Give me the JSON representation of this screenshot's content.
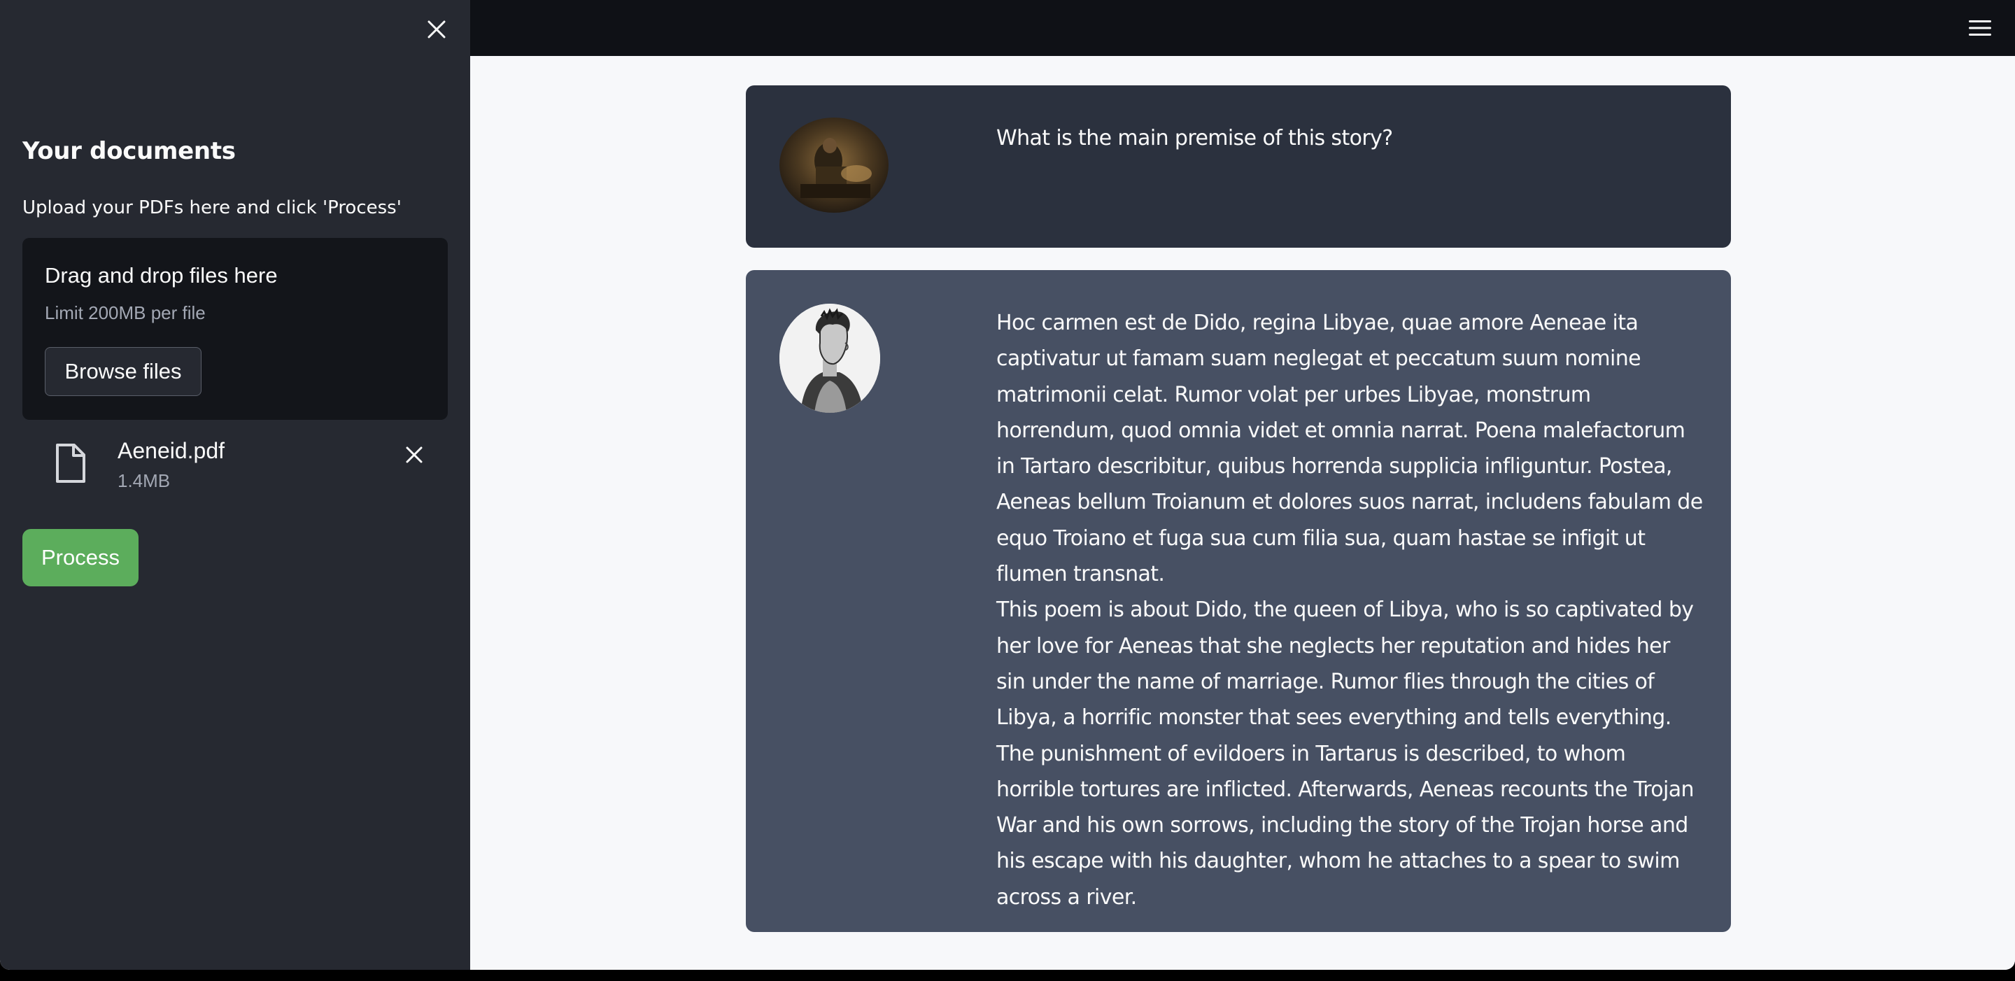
{
  "sidebar": {
    "title": "Your documents",
    "subtitle": "Upload your PDFs here and click 'Process'",
    "close_icon": "close-icon",
    "uploader": {
      "drag_text": "Drag and drop files here",
      "limit_text": "Limit 200MB per file",
      "browse_label": "Browse files"
    },
    "file": {
      "name": "Aeneid.pdf",
      "size": "1.4MB",
      "icon": "file-icon",
      "remove_icon": "close-icon"
    },
    "process_label": "Process"
  },
  "header": {
    "menu_icon": "hamburger-menu-icon"
  },
  "chat": {
    "messages": [
      {
        "role": "user",
        "avatar": "user-avatar-painting",
        "text": "What is the main premise of this story?"
      },
      {
        "role": "bot",
        "avatar": "bot-avatar-engraving-portrait",
        "text": "Hoc carmen est de Dido, regina Libyae, quae amore Aeneae ita captivatur ut famam suam neglegat et peccatum suum nomine matrimonii celat. Rumor volat per urbes Libyae, monstrum horrendum, quod omnia videt et omnia narrat. Poena malefactorum in Tartaro describitur, quibus horrenda supplicia infliguntur. Postea, Aeneas bellum Troianum et dolores suos narrat, includens fabulam de equo Troiano et fuga sua cum filia sua, quam hastae se infigit ut flumen transnat.\nThis poem is about Dido, the queen of Libya, who is so captivated by her love for Aeneas that she neglects her reputation and hides her sin under the name of marriage. Rumor flies through the cities of Libya, a horrific monster that sees everything and tells everything. The punishment of evildoers in Tartarus is described, to whom horrible tortures are inflicted. Afterwards, Aeneas recounts the Trojan War and his own sorrows, including the story of the Trojan horse and his escape with his daughter, whom he attaches to a spear to swim across a river."
      }
    ]
  },
  "colors": {
    "sidebar_bg": "#262931",
    "header_bg": "#0f1116",
    "main_bg": "#f7f8fa",
    "user_msg_bg": "#2b313e",
    "bot_msg_bg": "#475063",
    "process_btn": "#5cad5c"
  }
}
